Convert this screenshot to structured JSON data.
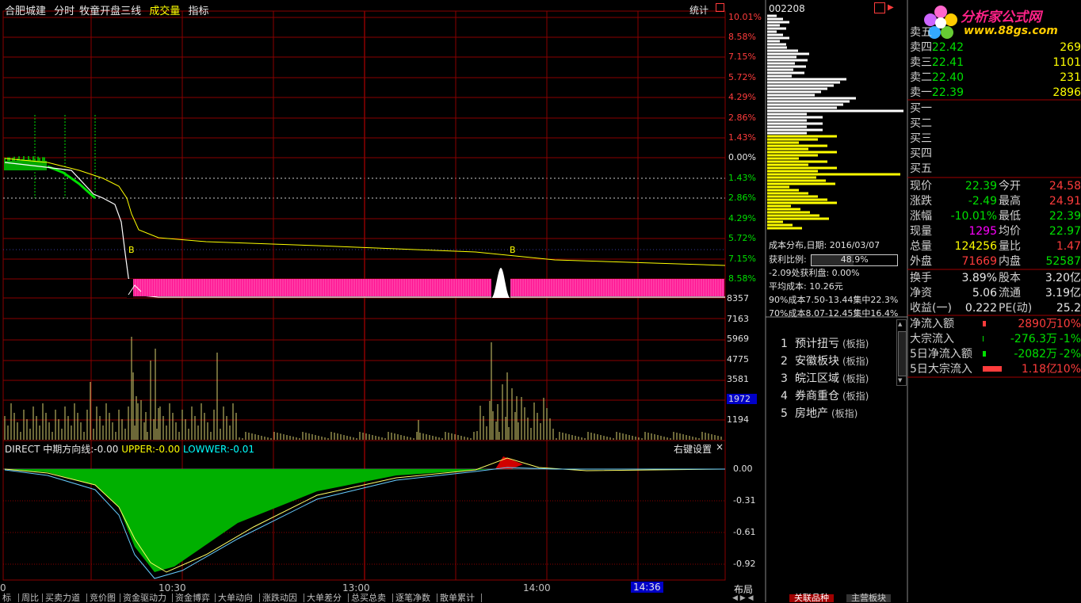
{
  "title_bar": {
    "stock_name": "合肥城建",
    "items": [
      "分时",
      "牧童开盘三线",
      "成交量",
      "指标"
    ],
    "stats_button": "统计"
  },
  "price_axis": {
    "right_pct": [
      "10.01%",
      "8.58%",
      "7.15%",
      "5.72%",
      "4.29%",
      "2.86%",
      "1.43%",
      "0.00%",
      "1.43%",
      "2.86%",
      "4.29%",
      "5.72%",
      "7.15%",
      "8.58%"
    ]
  },
  "volume_axis": {
    "labels": [
      "8357",
      "7163",
      "5969",
      "4775",
      "3581",
      "1972",
      "1194"
    ],
    "highlight": "1972"
  },
  "indicator": {
    "name": "DIRECT",
    "line1_label": "中期方向线:",
    "line1_value": "-0.00",
    "upper_label": "UPPER:",
    "upper_value": "-0.00",
    "lower_label": "LOWWER:",
    "lower_value": "-0.01",
    "settings": "右键设置",
    "close": "×",
    "axis": [
      "0.00",
      "-0.31",
      "-0.61",
      "-0.92"
    ]
  },
  "markers": {
    "b1": "B",
    "b2": "B"
  },
  "time_axis": {
    "labels": [
      "0",
      "10:30",
      "13:00",
      "14:00"
    ],
    "current": "14:36",
    "layout_btn": "布局"
  },
  "bottom_tabs": [
    "标",
    "周比",
    "买卖力道",
    "竞价图",
    "资金驱动力",
    "资金博弈",
    "大单动向",
    "涨跌动因",
    "大单差分",
    "总买总卖",
    "逐笔净数",
    "散单累计"
  ],
  "right_bottom_tabs": [
    "关联品种",
    "主营板块"
  ],
  "chip": {
    "code": "002208",
    "title": "成本分布,日期:",
    "date": "2016/03/07",
    "profit_label": "获利比例:",
    "profit_value": "48.9%",
    "profit_point": "-2.09处获利盘: 0.00%",
    "avg_cost": "平均成本: 10.26元",
    "c90": "90%成本7.50-13.44集中22.3%",
    "c70": "70%成本8.07-12.45集中16.4%"
  },
  "sectors": [
    {
      "n": "1",
      "name": "预计扭亏",
      "type": "(板指)"
    },
    {
      "n": "2",
      "name": "安徽板块",
      "type": "(板指)"
    },
    {
      "n": "3",
      "name": "皖江区域",
      "type": "(板指)"
    },
    {
      "n": "4",
      "name": "券商重仓",
      "type": "(板指)"
    },
    {
      "n": "5",
      "name": "房地产",
      "type": "(板指)"
    }
  ],
  "logo": {
    "name": "分析家公式网",
    "url": "www.88gs.com"
  },
  "order_book": {
    "sell": [
      {
        "label": "卖五",
        "price": "",
        "vol": ""
      },
      {
        "label": "卖四",
        "price": "22.42",
        "vol": "269"
      },
      {
        "label": "卖三",
        "price": "22.41",
        "vol": "1101"
      },
      {
        "label": "卖二",
        "price": "22.40",
        "vol": "231"
      },
      {
        "label": "卖一",
        "price": "22.39",
        "vol": "2896"
      }
    ],
    "buy": [
      {
        "label": "买一"
      },
      {
        "label": "买二"
      },
      {
        "label": "买三"
      },
      {
        "label": "买四"
      },
      {
        "label": "买五"
      }
    ]
  },
  "stats": [
    {
      "l1": "现价",
      "v1": "22.39",
      "c1": "green",
      "l2": "今开",
      "v2": "24.58",
      "c2": "red"
    },
    {
      "l1": "涨跌",
      "v1": "-2.49",
      "c1": "green",
      "l2": "最高",
      "v2": "24.91",
      "c2": "red"
    },
    {
      "l1": "涨幅",
      "v1": "-10.01%",
      "c1": "green",
      "l2": "最低",
      "v2": "22.39",
      "c2": "green"
    },
    {
      "l1": "现量",
      "v1": "1295",
      "c1": "magenta",
      "l2": "均价",
      "v2": "22.97",
      "c2": "green"
    },
    {
      "l1": "总量",
      "v1": "124256",
      "c1": "yellow",
      "l2": "量比",
      "v2": "1.47",
      "c2": "red"
    },
    {
      "l1": "外盘",
      "v1": "71669",
      "c1": "red",
      "l2": "内盘",
      "v2": "52587",
      "c2": "green"
    },
    {
      "l1": "换手",
      "v1": "3.89%",
      "c1": "white",
      "l2": "股本",
      "v2": "3.20亿",
      "c2": "white"
    },
    {
      "l1": "净资",
      "v1": "5.06",
      "c1": "white",
      "l2": "流通",
      "v2": "3.19亿",
      "c2": "white"
    },
    {
      "l1": "收益(一)",
      "v1": "0.222",
      "c1": "white",
      "l2": "PE(动)",
      "v2": "25.2",
      "c2": "white"
    }
  ],
  "flows": [
    {
      "label": "净流入额",
      "amount": "2890万",
      "pct": "10%",
      "color": "red"
    },
    {
      "label": "大宗流入",
      "amount": "-276.3万",
      "pct": "-1%",
      "color": "green"
    },
    {
      "label": "5日净流入额",
      "amount": "-2082万",
      "pct": "-2%",
      "color": "green"
    },
    {
      "label": "5日大宗流入",
      "amount": "1.18亿",
      "pct": "10%",
      "color": "red"
    }
  ],
  "colors": {
    "grid": "#8a0000",
    "up": "#ff3c3c",
    "down": "#00e000",
    "price_line": "#ffffff",
    "avg_line": "#ffff00",
    "chip_profit": "#ffff00",
    "chip_loss": "#ffffff",
    "limit_bar": "#ff1493"
  }
}
